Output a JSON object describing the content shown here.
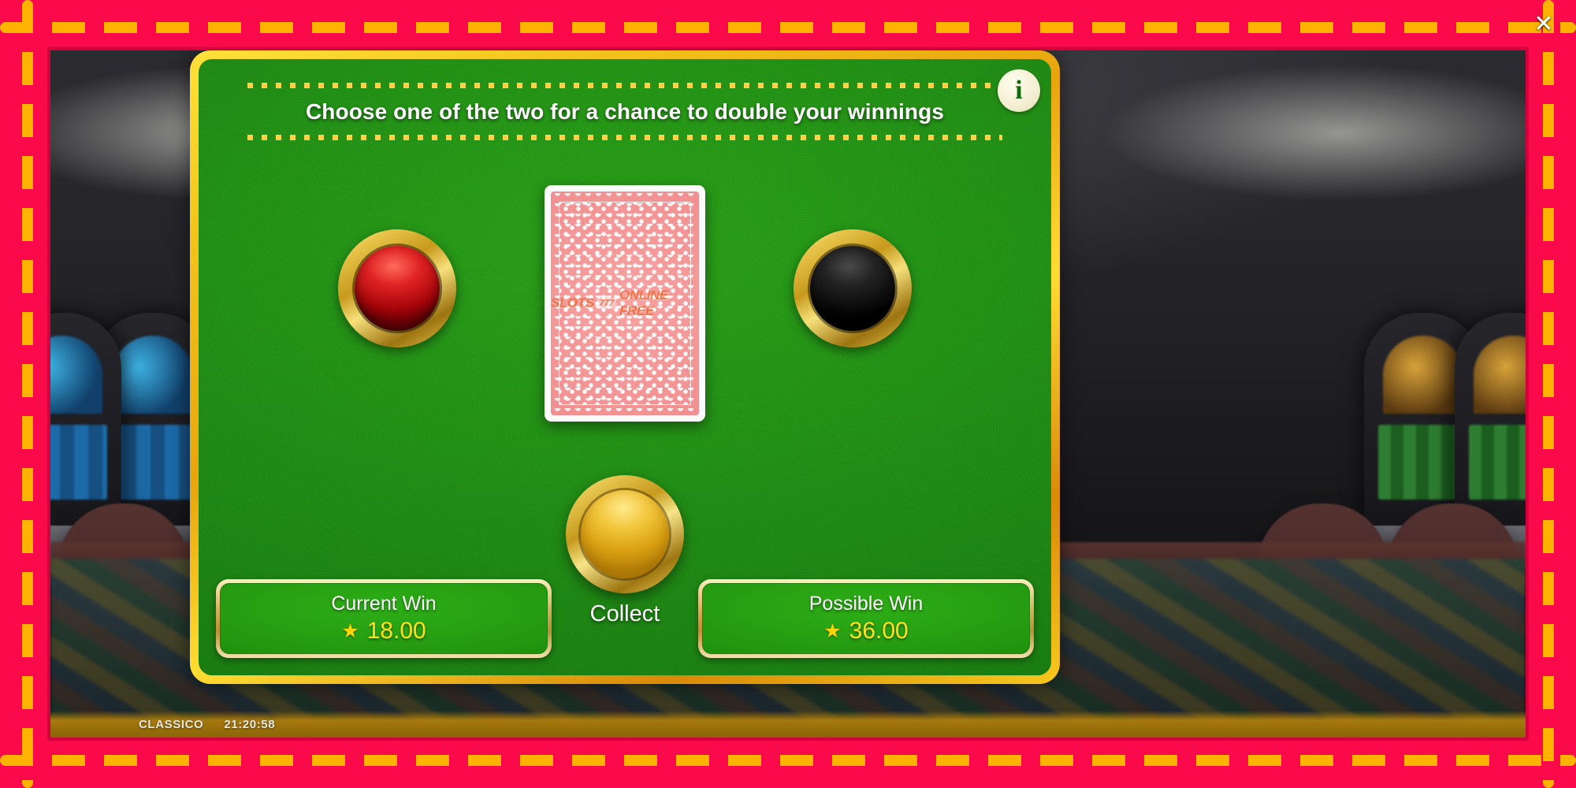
{
  "window": {
    "close_label": "✕"
  },
  "frame": {
    "border_color": "#FA0A4B",
    "dash_color": "#FFB300"
  },
  "gamble": {
    "title": "Choose one of the two for a chance to double your winnings",
    "info_label": "i",
    "info_icon": "info-icon",
    "felt_color": "#1D8F10",
    "frame_color": "#F3C41B",
    "card": {
      "watermark_left": "SLOTS",
      "watermark_chip": "777",
      "watermark_right": "ONLINE FREE",
      "back_color": "#F18F90"
    },
    "buttons": {
      "red_label": "red-choice",
      "red_color": "#E02323",
      "black_label": "black-choice",
      "black_color": "#111111",
      "collect_label": "Collect",
      "collect_color": "#F2C63C"
    },
    "panels": [
      {
        "title": "Current Win",
        "star": "★",
        "value": "18.00"
      },
      {
        "title": "Possible Win",
        "star": "★",
        "value": "36.00"
      }
    ]
  },
  "status": {
    "game_name": "CLASSICO",
    "time": "21:20:58"
  }
}
